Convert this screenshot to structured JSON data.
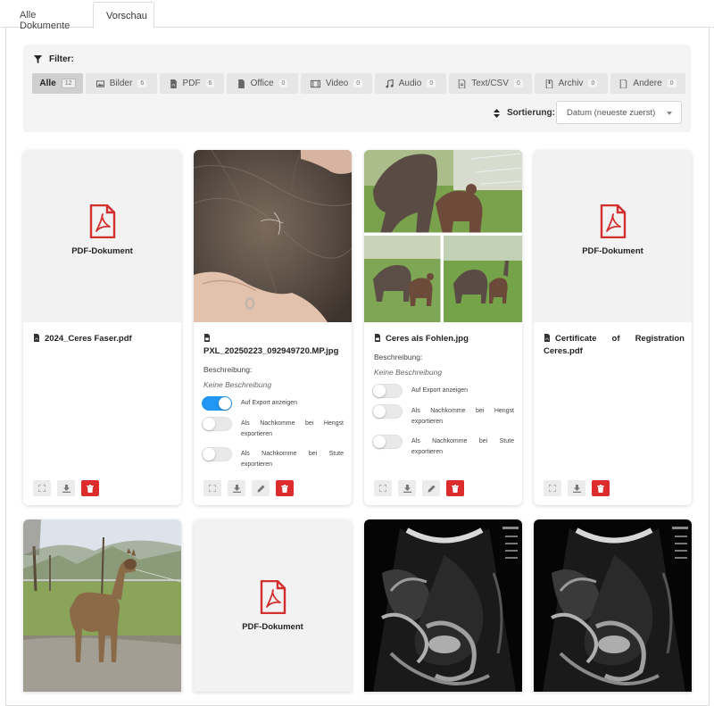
{
  "tabs": [
    {
      "label": "Alle Dokumente"
    },
    {
      "label": "Vorschau"
    }
  ],
  "filter": {
    "title": "Filter:",
    "chips": [
      {
        "label": "Alle",
        "count": "12",
        "icon": "none"
      },
      {
        "label": "Bilder",
        "count": "6",
        "icon": "image-icon"
      },
      {
        "label": "PDF",
        "count": "6",
        "icon": "pdf-icon"
      },
      {
        "label": "Office",
        "count": "0",
        "icon": "document-icon"
      },
      {
        "label": "Video",
        "count": "0",
        "icon": "film-icon"
      },
      {
        "label": "Audio",
        "count": "0",
        "icon": "music-icon"
      },
      {
        "label": "Text/CSV",
        "count": "0",
        "icon": "text-file-icon"
      },
      {
        "label": "Archiv",
        "count": "0",
        "icon": "archive-icon"
      },
      {
        "label": "Andere",
        "count": "0",
        "icon": "file-icon"
      }
    ]
  },
  "sort": {
    "label": "Sortierung:",
    "value": "Datum (neueste zuerst)"
  },
  "cards": [
    {
      "type": "pdf",
      "thumb_label": "PDF-Dokument",
      "filename": "2024_Ceres Faser.pdf"
    },
    {
      "type": "image",
      "filename": "PXL_20250223_092949720.MP.jpg",
      "desc_label": "Beschreibung:",
      "desc_value": "Keine Beschreibung",
      "toggles": [
        {
          "label": "Auf Export anzeigen",
          "on": true
        },
        {
          "label": "Als Nachkomme bei Hengst exportieren",
          "on": false
        },
        {
          "label": "Als Nachkomme bei Stute exportieren",
          "on": false
        }
      ]
    },
    {
      "type": "image",
      "filename": "Ceres als Fohlen.jpg",
      "desc_label": "Beschreibung:",
      "desc_value": "Keine Beschreibung",
      "toggles": [
        {
          "label": "Auf Export anzeigen",
          "on": false
        },
        {
          "label": "Als Nachkomme bei Hengst exportieren",
          "on": false
        },
        {
          "label": "Als Nachkomme bei Stute exportieren",
          "on": false
        }
      ]
    },
    {
      "type": "pdf",
      "thumb_label": "PDF-Dokument",
      "filename": "Certificate of Registration Ceres.pdf"
    },
    {
      "type": "image"
    },
    {
      "type": "pdf",
      "thumb_label": "PDF-Dokument"
    },
    {
      "type": "image"
    },
    {
      "type": "image"
    }
  ],
  "colors": {
    "accent_blue": "#2196f3",
    "delete_red": "#dd2c2c",
    "pdf_red": "#d32f2f"
  }
}
